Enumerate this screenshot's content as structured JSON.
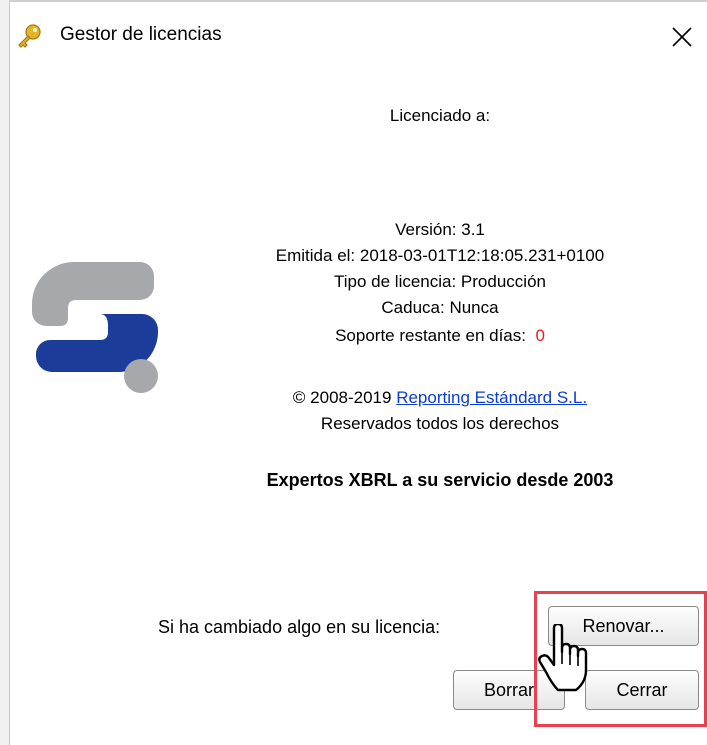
{
  "window": {
    "title": "Gestor de licencias",
    "close_label": "×"
  },
  "license": {
    "licensed_to_label": "Licenciado a:",
    "version": "Versión: 3.1",
    "issued": "Emitida el: 2018-03-01T12:18:05.231+0100",
    "type": "Tipo de licencia: Producción",
    "expires": "Caduca: Nunca",
    "support_label": "Soporte restante en días:",
    "support_days": "0"
  },
  "footer": {
    "copyright_prefix": "© 2008-2019",
    "company_link": "Reporting Estándard S.L.",
    "rights": "Reservados todos los derechos",
    "slogan": "Expertos XBRL a su servicio desde 2003"
  },
  "actions": {
    "renew_prompt": "Si ha cambiado algo en su licencia:",
    "renew_button": "Renovar...",
    "delete_button": "Borrar",
    "close_button": "Cerrar"
  },
  "colors": {
    "logo_gray": "#a7a8ab",
    "logo_blue": "#1c3c99",
    "highlight": "#e8404c",
    "zero_red": "#e02020",
    "link_blue": "#0b3dd6"
  }
}
